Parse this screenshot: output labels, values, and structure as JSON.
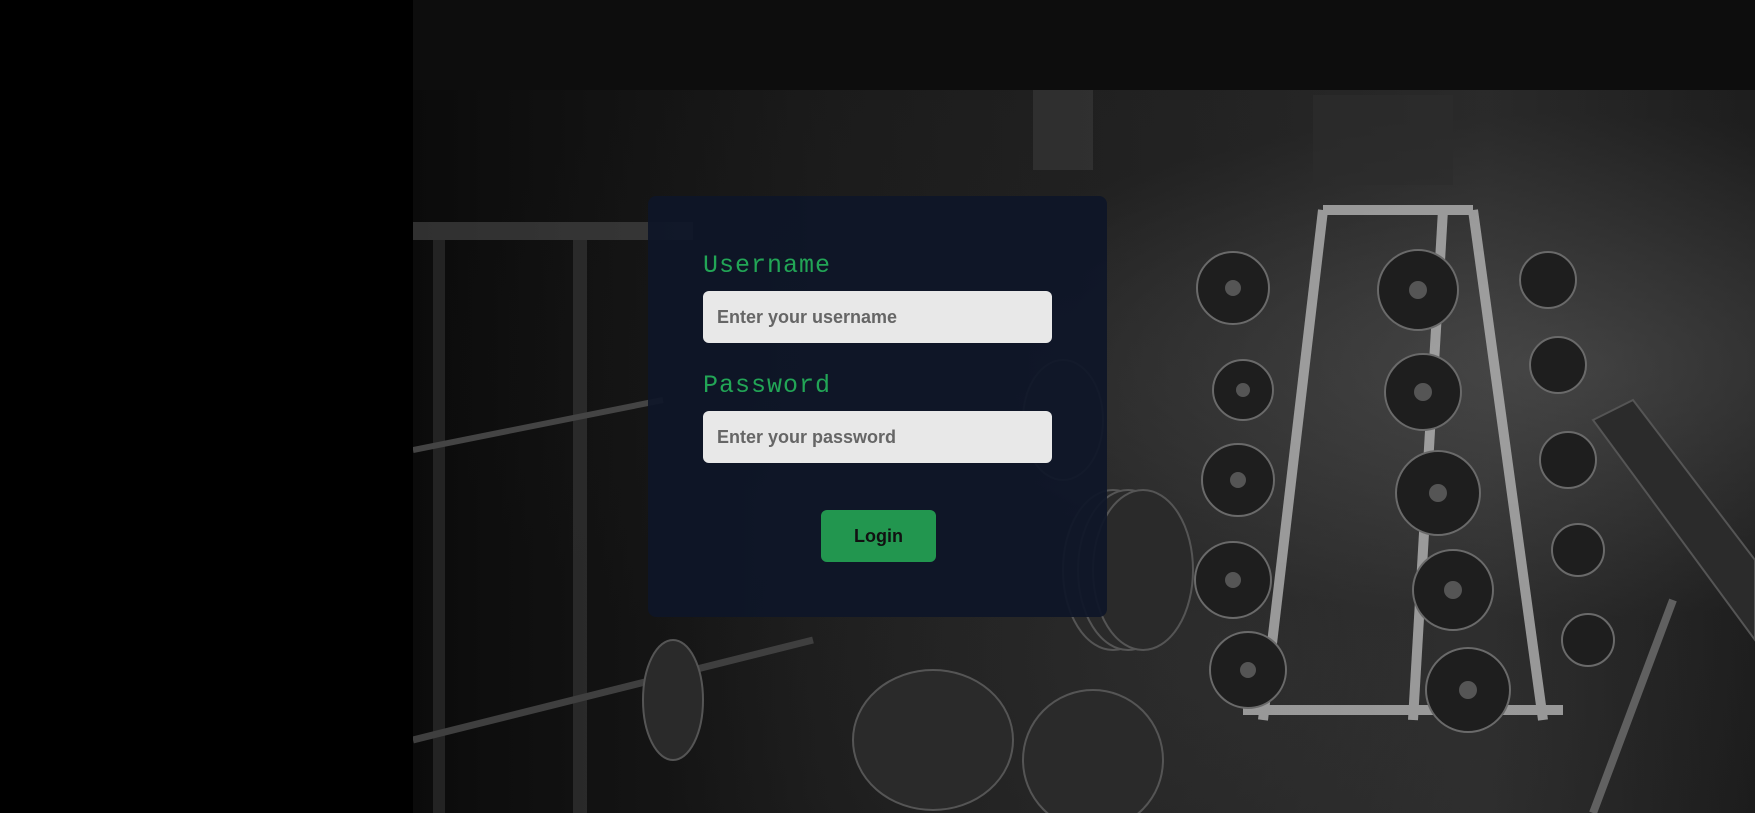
{
  "background": {
    "image_icon": "gym-weights-background-photo"
  },
  "login_form": {
    "username_label": "Username",
    "username_placeholder": "Enter your username",
    "username_value": "",
    "password_label": "Password",
    "password_placeholder": "Enter your password",
    "password_value": "",
    "login_button_label": "Login"
  },
  "colors": {
    "accent": "#22a556",
    "button": "#22964f",
    "card": "#0e1628",
    "input_bg": "#e8e8e8"
  }
}
